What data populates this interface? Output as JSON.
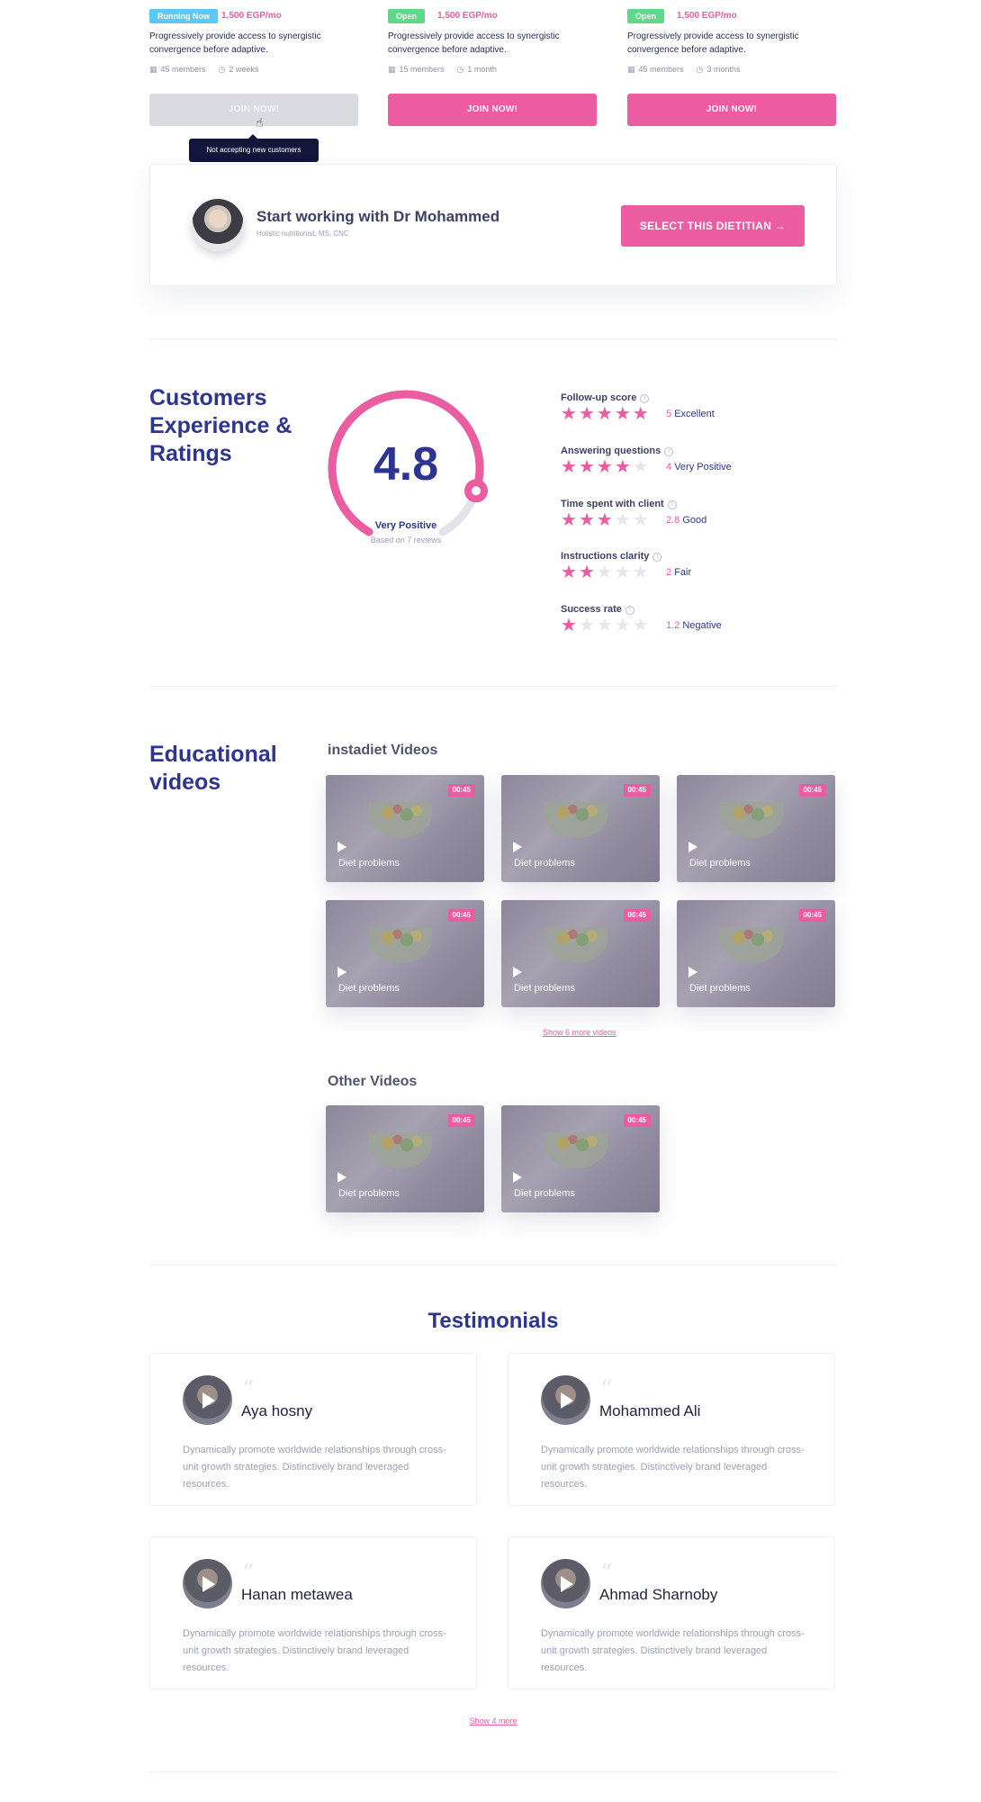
{
  "plans": [
    {
      "badge": "Running Now",
      "badge_color": "#5bc8f5",
      "price": "1,500 EGP/mo",
      "desc": "Progressively provide access to synergistic convergence before adaptive.",
      "members": "45 members",
      "duration": "2 weeks",
      "button": "JOIN NOW!",
      "disabled": true
    },
    {
      "badge": "Open",
      "badge_color": "#5ed98a",
      "price": "1,500 EGP/mo",
      "desc": "Progressively provide access to synergistic convergence before adaptive.",
      "members": "15 members",
      "duration": "1 month",
      "button": "JOIN NOW!",
      "disabled": false
    },
    {
      "badge": "Open",
      "badge_color": "#5ed98a",
      "price": "1,500 EGP/mo",
      "desc": "Progressively provide access to synergistic convergence before adaptive.",
      "members": "45 members",
      "duration": "3 months",
      "button": "JOIN NOW!",
      "disabled": false
    }
  ],
  "tooltip": "Not accepting new customers",
  "dietitian": {
    "title": "Start working with Dr Mohammed",
    "subtitle": "Holistic nutritionist, MS, CNC",
    "button": "SELECT THIS DIETITIAN"
  },
  "experience": {
    "title_line1": "Customers",
    "title_line2": "Experience &",
    "title_line3": "Ratings",
    "score": "4.8",
    "score_fraction": 0.86,
    "verdict": "Very Positive",
    "based_on": "Based on 7 reviews",
    "ratings": [
      {
        "label": "Follow-up score",
        "value": "5",
        "word": "Excellent",
        "stars": 5
      },
      {
        "label": "Answering questions",
        "value": "4",
        "word": "Very Positive",
        "stars": 4
      },
      {
        "label": "Time spent with client",
        "value": "2.8",
        "word": "Good",
        "stars": 3
      },
      {
        "label": "Instructions clarity",
        "value": "2",
        "word": "Fair",
        "stars": 2
      },
      {
        "label": "Success rate",
        "value": "1.2",
        "word": "Negative",
        "stars": 1
      }
    ]
  },
  "videos": {
    "title_line1": "Educational",
    "title_line2": "videos",
    "instadiet_title": "instadiet Videos",
    "instadiet": [
      {
        "duration": "00:45",
        "label": "Diet problems"
      },
      {
        "duration": "00:45",
        "label": "Diet problems"
      },
      {
        "duration": "00:45",
        "label": "Diet problems"
      },
      {
        "duration": "00:45",
        "label": "Diet problems"
      },
      {
        "duration": "00:45",
        "label": "Diet problems"
      },
      {
        "duration": "00:45",
        "label": "Diet problems"
      }
    ],
    "show_more": "Show 6 more videos",
    "other_title": "Other Videos",
    "other": [
      {
        "duration": "00:45",
        "label": "Diet problems"
      },
      {
        "duration": "00:45",
        "label": "Diet problems"
      }
    ]
  },
  "testimonials": {
    "title": "Testimonials",
    "items": [
      {
        "name": "Aya hosny",
        "text": "Dynamically promote worldwide relationships through cross-unit growth strategies. Distinctively brand leveraged resources."
      },
      {
        "name": "Mohammed Ali",
        "text": "Dynamically promote worldwide relationships through cross-unit growth strategies. Distinctively brand leveraged resources."
      },
      {
        "name": "Hanan metawea",
        "text": "Dynamically promote worldwide relationships through cross-unit growth strategies. Distinctively brand leveraged resources."
      },
      {
        "name": "Ahmad Sharnoby",
        "text": "Dynamically promote worldwide relationships through cross-unit growth strategies. Distinctively brand leveraged resources."
      }
    ],
    "show_more": "Show 4 more"
  },
  "colors": {
    "accent": "#ec5ca0",
    "primary": "#2d3590",
    "disabled": "#dadbe0"
  }
}
